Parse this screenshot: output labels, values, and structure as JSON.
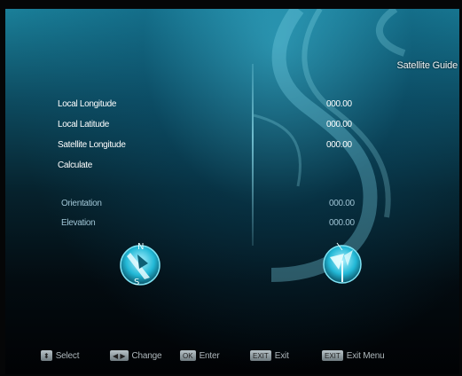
{
  "screen": {
    "title": "Satellite Guide"
  },
  "form": {
    "rows": [
      {
        "label": "Local Longitude",
        "value": "000.00"
      },
      {
        "label": "Local Latitude",
        "value": "000.00"
      },
      {
        "label": "Satellite Longitude",
        "value": "000.00"
      },
      {
        "label": "Calculate",
        "value": ""
      }
    ]
  },
  "results": {
    "orientation_label": "Orientation",
    "orientation_value": "000.00",
    "elevation_label": "Elevation",
    "elevation_value": "000.00"
  },
  "compass_left": {
    "north": "N",
    "south": "S"
  },
  "footer": {
    "hints": [
      {
        "key": "⬍",
        "label": "Select"
      },
      {
        "key": "◀ ▶",
        "label": "Change"
      },
      {
        "key": "OK",
        "label": "Enter"
      },
      {
        "key": "EXIT",
        "label": "Exit"
      },
      {
        "key": "EXIT",
        "label": "Exit Menu"
      }
    ]
  },
  "colors": {
    "accent": "#1a7f99",
    "text": "#ffffff"
  }
}
